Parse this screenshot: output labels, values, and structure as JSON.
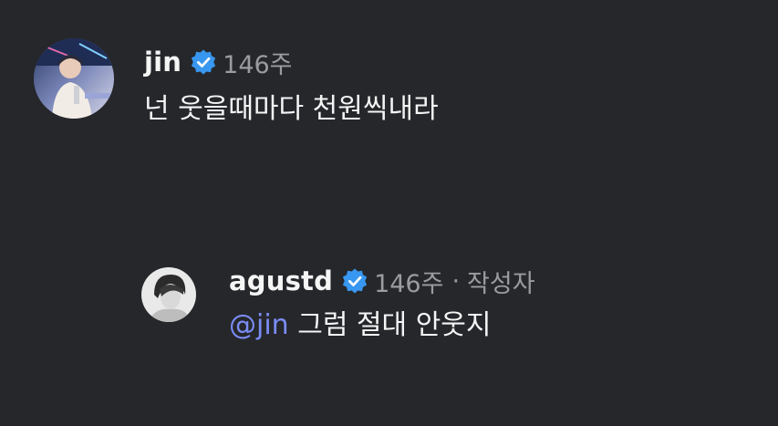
{
  "comments": [
    {
      "username": "jin",
      "time": "146주",
      "text": "넌 웃을때마다 천원씩내라"
    }
  ],
  "reply": {
    "username": "agustd",
    "time": "146주",
    "separator": "·",
    "author_tag": "작성자",
    "mention": "@jin",
    "text": " 그럼 절대 안웃지"
  },
  "colors": {
    "background": "#25272b",
    "text": "#f5f5f5",
    "muted": "#9a9ca0",
    "verified": "#3897f0",
    "mention": "#7b8cf5"
  },
  "icons": {
    "verified": "verified-badge-icon"
  }
}
